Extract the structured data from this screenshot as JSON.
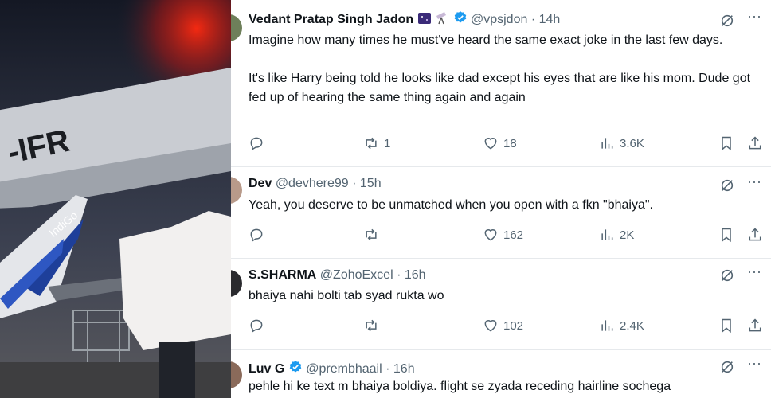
{
  "photo": {
    "tail_text": "-IFR",
    "logo_text": "IndiGo"
  },
  "tweets": [
    {
      "name": "Vedant Pratap Singh Jadon",
      "handle": "@vpsjdon",
      "time": "14h",
      "paragraphs": [
        "Imagine how many times he must've heard the same exact joke in the last few days.",
        "It's like Harry being told he looks like dad except his eyes that are like his mom. Dude got fed up of hearing the same thing again and again"
      ],
      "replies": "",
      "reposts": "1",
      "likes": "18",
      "views": "3.6K"
    },
    {
      "name": "Dev",
      "handle": "@devhere99",
      "time": "15h",
      "paragraphs": [
        "Yeah, you deserve to be unmatched when you open with a fkn \"bhaiya\"."
      ],
      "replies": "",
      "reposts": "",
      "likes": "162",
      "views": "2K"
    },
    {
      "name": "S.SHARMA",
      "handle": "@ZohoExcel",
      "time": "16h",
      "paragraphs": [
        "bhaiya nahi bolti tab syad rukta wo"
      ],
      "replies": "",
      "reposts": "",
      "likes": "102",
      "views": "2.4K"
    },
    {
      "name": "Luv G",
      "handle": "@prembhaail",
      "time": "16h",
      "paragraphs": [
        "pehle hi ke text m bhaiya boldiya. flight se zyada receding hairline sochega"
      ]
    }
  ],
  "separator": "·",
  "more_glyph": "···",
  "icons": [
    "reply-icon",
    "repost-icon",
    "like-icon",
    "views-icon",
    "bookmark-icon",
    "share-icon",
    "grok-icon",
    "verified-badge-icon"
  ],
  "colors": {
    "text": "#0f1419",
    "muted": "#536471",
    "verified": "#1d9bf0"
  }
}
